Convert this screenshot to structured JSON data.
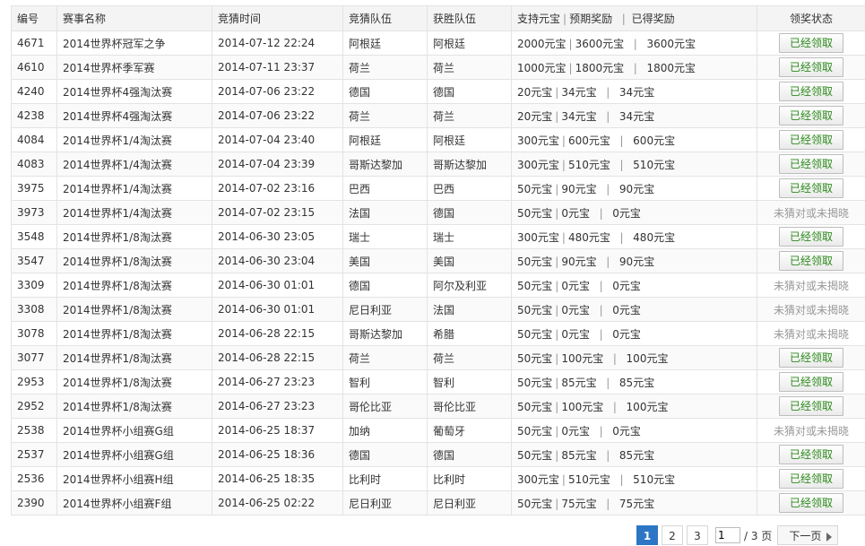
{
  "headers": {
    "id": "编号",
    "event": "赛事名称",
    "time": "竞猜时间",
    "team": "竞猜队伍",
    "winner": "获胜队伍",
    "bet": "支持元宝",
    "expected": "预期奖励",
    "earned": "已得奖励",
    "status": "领奖状态"
  },
  "rows": [
    {
      "id": "4671",
      "event": "2014世界杯冠军之争",
      "time": "2014-07-12 22:24",
      "team": "阿根廷",
      "winner": "阿根廷",
      "bet": "2000元宝",
      "expected": "3600元宝",
      "earned": "3600元宝",
      "status": "已经领取"
    },
    {
      "id": "4610",
      "event": "2014世界杯季军赛",
      "time": "2014-07-11 23:37",
      "team": "荷兰",
      "winner": "荷兰",
      "bet": "1000元宝",
      "expected": "1800元宝",
      "earned": "1800元宝",
      "status": "已经领取"
    },
    {
      "id": "4240",
      "event": "2014世界杯4强淘汰赛",
      "time": "2014-07-06 23:22",
      "team": "德国",
      "winner": "德国",
      "bet": "20元宝",
      "expected": "34元宝",
      "earned": "34元宝",
      "status": "已经领取"
    },
    {
      "id": "4238",
      "event": "2014世界杯4强淘汰赛",
      "time": "2014-07-06 23:22",
      "team": "荷兰",
      "winner": "荷兰",
      "bet": "20元宝",
      "expected": "34元宝",
      "earned": "34元宝",
      "status": "已经领取"
    },
    {
      "id": "4084",
      "event": "2014世界杯1/4淘汰赛",
      "time": "2014-07-04 23:40",
      "team": "阿根廷",
      "winner": "阿根廷",
      "bet": "300元宝",
      "expected": "600元宝",
      "earned": "600元宝",
      "status": "已经领取"
    },
    {
      "id": "4083",
      "event": "2014世界杯1/4淘汰赛",
      "time": "2014-07-04 23:39",
      "team": "哥斯达黎加",
      "winner": "哥斯达黎加",
      "bet": "300元宝",
      "expected": "510元宝",
      "earned": "510元宝",
      "status": "已经领取"
    },
    {
      "id": "3975",
      "event": "2014世界杯1/4淘汰赛",
      "time": "2014-07-02 23:16",
      "team": "巴西",
      "winner": "巴西",
      "bet": "50元宝",
      "expected": "90元宝",
      "earned": "90元宝",
      "status": "已经领取"
    },
    {
      "id": "3973",
      "event": "2014世界杯1/4淘汰赛",
      "time": "2014-07-02 23:15",
      "team": "法国",
      "winner": "德国",
      "bet": "50元宝",
      "expected": "0元宝",
      "earned": "0元宝",
      "status": "未猜对或未揭晓"
    },
    {
      "id": "3548",
      "event": "2014世界杯1/8淘汰赛",
      "time": "2014-06-30 23:05",
      "team": "瑞士",
      "winner": "瑞士",
      "bet": "300元宝",
      "expected": "480元宝",
      "earned": "480元宝",
      "status": "已经领取"
    },
    {
      "id": "3547",
      "event": "2014世界杯1/8淘汰赛",
      "time": "2014-06-30 23:04",
      "team": "美国",
      "winner": "美国",
      "bet": "50元宝",
      "expected": "90元宝",
      "earned": "90元宝",
      "status": "已经领取"
    },
    {
      "id": "3309",
      "event": "2014世界杯1/8淘汰赛",
      "time": "2014-06-30 01:01",
      "team": "德国",
      "winner": "阿尔及利亚",
      "bet": "50元宝",
      "expected": "0元宝",
      "earned": "0元宝",
      "status": "未猜对或未揭晓"
    },
    {
      "id": "3308",
      "event": "2014世界杯1/8淘汰赛",
      "time": "2014-06-30 01:01",
      "team": "尼日利亚",
      "winner": "法国",
      "bet": "50元宝",
      "expected": "0元宝",
      "earned": "0元宝",
      "status": "未猜对或未揭晓"
    },
    {
      "id": "3078",
      "event": "2014世界杯1/8淘汰赛",
      "time": "2014-06-28 22:15",
      "team": "哥斯达黎加",
      "winner": "希腊",
      "bet": "50元宝",
      "expected": "0元宝",
      "earned": "0元宝",
      "status": "未猜对或未揭晓"
    },
    {
      "id": "3077",
      "event": "2014世界杯1/8淘汰赛",
      "time": "2014-06-28 22:15",
      "team": "荷兰",
      "winner": "荷兰",
      "bet": "50元宝",
      "expected": "100元宝",
      "earned": "100元宝",
      "status": "已经领取"
    },
    {
      "id": "2953",
      "event": "2014世界杯1/8淘汰赛",
      "time": "2014-06-27 23:23",
      "team": "智利",
      "winner": "智利",
      "bet": "50元宝",
      "expected": "85元宝",
      "earned": "85元宝",
      "status": "已经领取"
    },
    {
      "id": "2952",
      "event": "2014世界杯1/8淘汰赛",
      "time": "2014-06-27 23:23",
      "team": "哥伦比亚",
      "winner": "哥伦比亚",
      "bet": "50元宝",
      "expected": "100元宝",
      "earned": "100元宝",
      "status": "已经领取"
    },
    {
      "id": "2538",
      "event": "2014世界杯小组赛G组",
      "time": "2014-06-25 18:37",
      "team": "加纳",
      "winner": "葡萄牙",
      "bet": "50元宝",
      "expected": "0元宝",
      "earned": "0元宝",
      "status": "未猜对或未揭晓"
    },
    {
      "id": "2537",
      "event": "2014世界杯小组赛G组",
      "time": "2014-06-25 18:36",
      "team": "德国",
      "winner": "德国",
      "bet": "50元宝",
      "expected": "85元宝",
      "earned": "85元宝",
      "status": "已经领取"
    },
    {
      "id": "2536",
      "event": "2014世界杯小组赛H组",
      "time": "2014-06-25 18:35",
      "team": "比利时",
      "winner": "比利时",
      "bet": "300元宝",
      "expected": "510元宝",
      "earned": "510元宝",
      "status": "已经领取"
    },
    {
      "id": "2390",
      "event": "2014世界杯小组赛F组",
      "time": "2014-06-25 02:22",
      "team": "尼日利亚",
      "winner": "尼日利亚",
      "bet": "50元宝",
      "expected": "75元宝",
      "earned": "75元宝",
      "status": "已经领取"
    }
  ],
  "pagination": {
    "pages": [
      "1",
      "2",
      "3"
    ],
    "current": "1",
    "input_value": "1",
    "total": "/ 3 页",
    "next": "下一页"
  }
}
